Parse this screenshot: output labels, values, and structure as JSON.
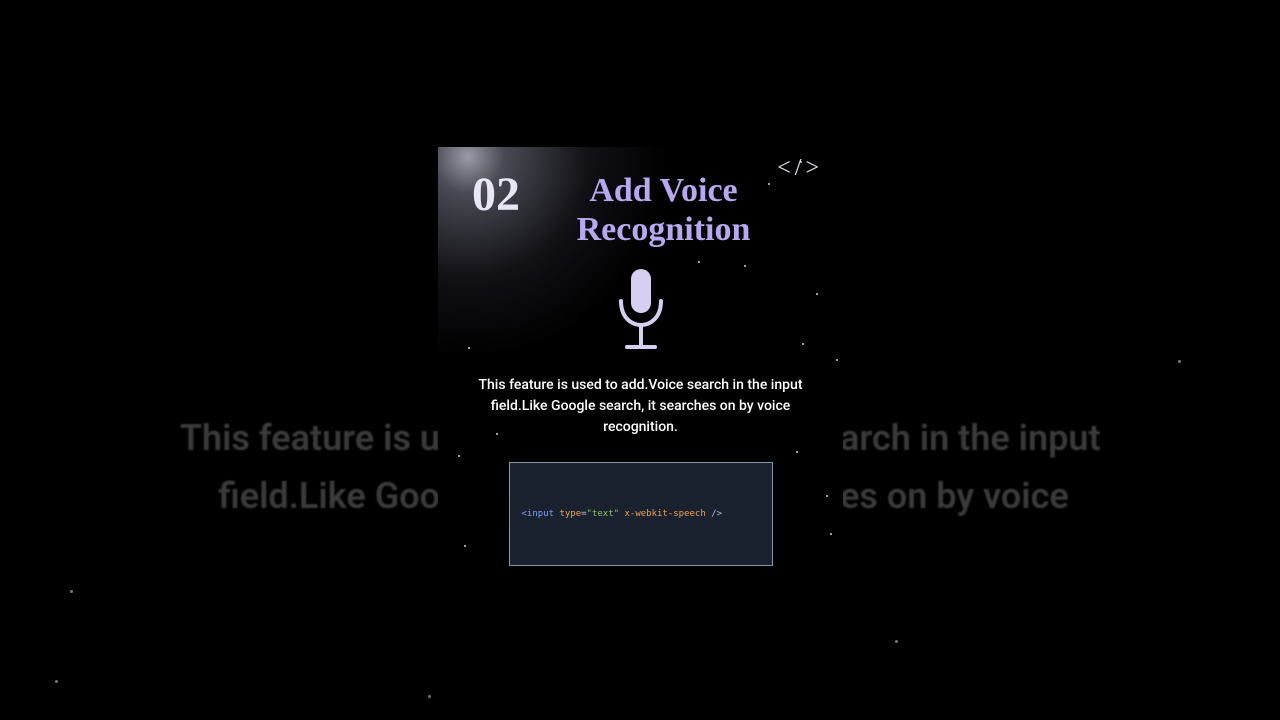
{
  "step": {
    "number": "02",
    "title_line1": "Add Voice",
    "title_line2": "Recognition"
  },
  "description": "This feature is used to add.Voice search in the input field.Like Google search, it searches on by voice recognition.",
  "code": {
    "tag_open": "<input",
    "attr_type": "type",
    "attr_type_val": "\"text\"",
    "attr_speech": "x-webkit-speech",
    "close": "/>"
  },
  "bg_ghost": {
    "left_line1": "This feature is u",
    "left_line2": "field.Like Goo",
    "right_line1": "arch in the input",
    "right_line2": "es on by voice"
  },
  "icons": {
    "code_badge": "</>"
  },
  "colors": {
    "accent": "#b8a8f0",
    "card_bg": "#111116",
    "code_bg": "#1a2230"
  }
}
